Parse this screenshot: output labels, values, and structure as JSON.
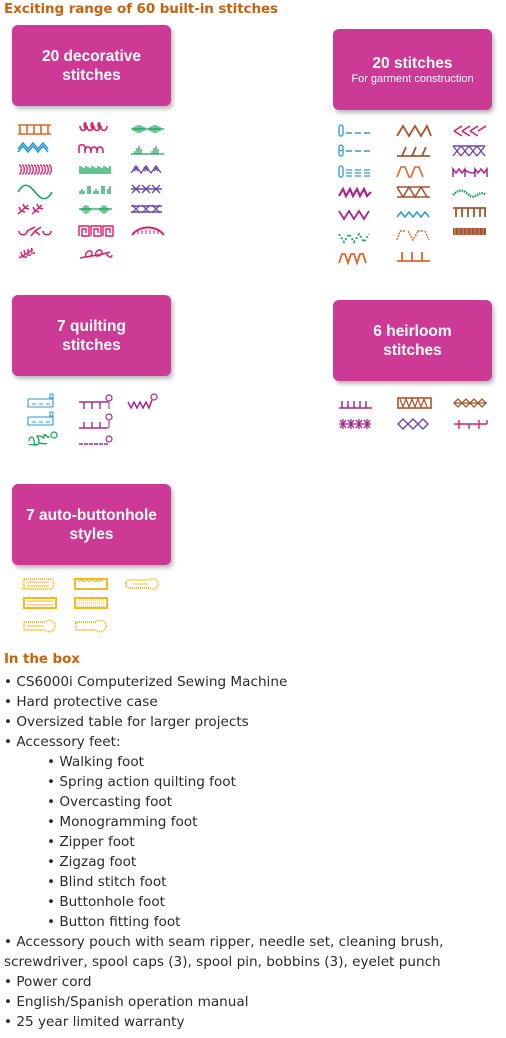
{
  "stitches_section": {
    "heading": "Exciting range of 60 built-in stitches",
    "groups": [
      {
        "id": "decorative",
        "title": "20 decorative",
        "title_line2": "stitches",
        "subtitle": ""
      },
      {
        "id": "garment",
        "title": "20 stitches",
        "title_line2": "",
        "subtitle": "For garment construction"
      },
      {
        "id": "quilting",
        "title": "7 quilting",
        "title_line2": "stitches",
        "subtitle": ""
      },
      {
        "id": "heirloom",
        "title": "6 heirloom",
        "title_line2": "stitches",
        "subtitle": ""
      },
      {
        "id": "buttonhole",
        "title": "7 auto-buttonhole",
        "title_line2": "styles",
        "subtitle": ""
      }
    ],
    "colors": {
      "box": "#cc3a96",
      "orange": "#e0662a",
      "blue": "#2a9ad6",
      "pink": "#d8226a",
      "green": "#1aa05a",
      "purple": "#6a4aa8",
      "magenta": "#a8268e",
      "brown": "#a4552e",
      "yellow": "#f5b820"
    }
  },
  "in_the_box": {
    "heading": "In the box",
    "items": [
      "• CS6000i Computerized Sewing Machine",
      "• Hard protective case",
      "• Oversized table for larger projects",
      "• Accessory feet:"
    ],
    "feet": [
      "• Walking foot",
      "• Spring action quilting foot",
      "• Overcasting foot",
      "• Monogramming foot",
      "• Zipper foot",
      "• Zigzag foot",
      "• Blind stitch foot",
      "• Buttonhole foot",
      "• Button fitting foot"
    ],
    "items_after": [
      "• Accessory pouch with seam ripper, needle set, cleaning brush, screwdriver, spool caps (3), spool pin, bobbins (3), eyelet punch",
      "• Power cord",
      "• English/Spanish operation manual",
      "• 25 year limited warranty"
    ]
  }
}
